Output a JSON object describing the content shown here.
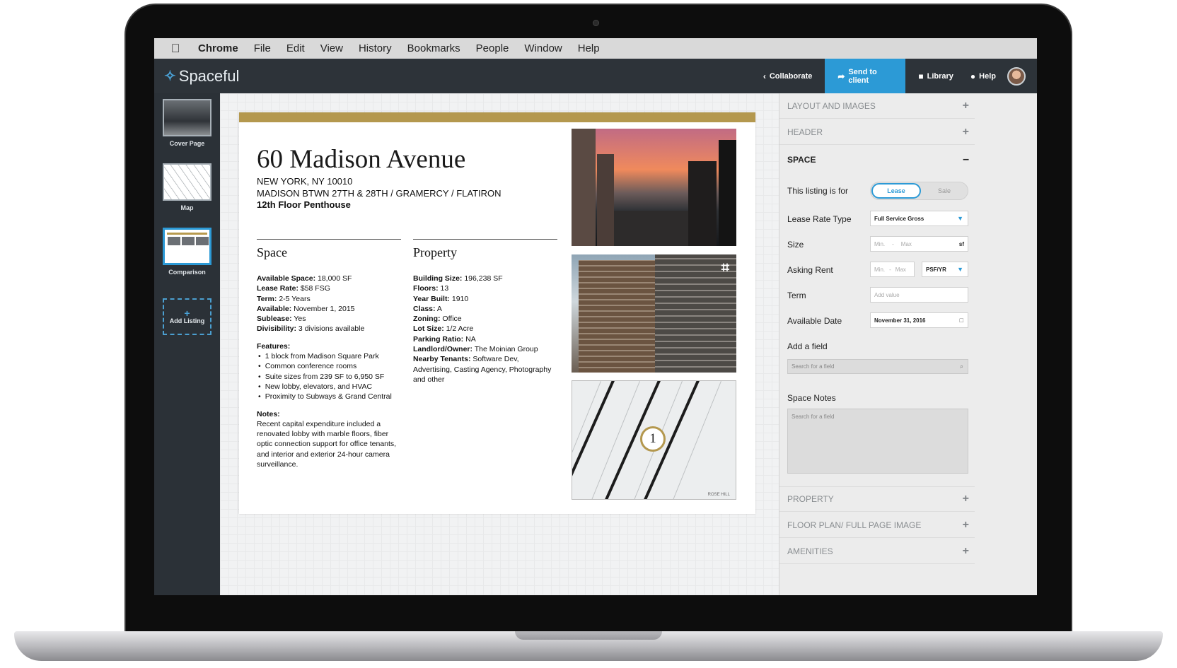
{
  "menubar": {
    "items": [
      "Chrome",
      "File",
      "Edit",
      "View",
      "History",
      "Bookmarks",
      "People",
      "Window",
      "Help"
    ]
  },
  "app": {
    "logo_text": "Spaceful",
    "collaborate_label": "Collaborate",
    "send_label": "Send to client",
    "library_label": "Library",
    "help_label": "Help"
  },
  "rail": {
    "pages": [
      {
        "label": "Cover Page"
      },
      {
        "label": "Map"
      },
      {
        "label": "Comparison"
      }
    ],
    "add_label": "Add Listing"
  },
  "document": {
    "title": "60 Madison Avenue",
    "city": "NEW YORK, NY 10010",
    "cross_streets": "MADISON BTWN 27TH & 28TH / GRAMERCY / FLATIRON",
    "floor": "12th Floor Penthouse",
    "space": {
      "heading": "Space",
      "rows": [
        {
          "k": "Available Space:",
          "v": " 18,000 SF"
        },
        {
          "k": "Lease Rate:",
          "v": " $58 FSG"
        },
        {
          "k": "Term:",
          "v": " 2-5 Years"
        },
        {
          "k": "Available:",
          "v": " November 1, 2015"
        },
        {
          "k": "Sublease:",
          "v": " Yes"
        },
        {
          "k": "Divisibility:",
          "v": " 3 divisions available"
        }
      ],
      "features_heading": "Features:",
      "features": [
        "1 block from Madison Square Park",
        "Common conference rooms",
        "Suite sizes from 239 SF to 6,950 SF",
        "New lobby, elevators, and HVAC",
        "Proximity to Subways & Grand Central"
      ],
      "notes_heading": "Notes:",
      "notes": "Recent capital expenditure included a renovated lobby with marble floors, fiber optic connection support for office tenants, and interior and exterior 24-hour camera surveillance."
    },
    "property": {
      "heading": "Property",
      "rows": [
        {
          "k": "Building Size:",
          "v": " 196,238 SF"
        },
        {
          "k": "Floors:",
          "v": " 13"
        },
        {
          "k": "Year Built:",
          "v": " 1910"
        },
        {
          "k": "Class:",
          "v": " A"
        },
        {
          "k": "Zoning:",
          "v": " Office"
        },
        {
          "k": "Lot Size:",
          "v": " 1/2 Acre"
        },
        {
          "k": "Parking Ratio:",
          "v": " NA"
        },
        {
          "k": "Landlord/Owner:",
          "v": " The Moinian Group"
        },
        {
          "k": "Nearby Tenants:",
          "v": " Software Dev, Advertising, Casting Agency, Photography and other"
        }
      ]
    },
    "map_marker": "1",
    "map_credit": "ROSE HILL"
  },
  "panel": {
    "sections_top": [
      {
        "label": "LAYOUT AND IMAGES",
        "toggle": "+"
      },
      {
        "label": "HEADER",
        "toggle": "+"
      }
    ],
    "space_section": {
      "label": "SPACE",
      "toggle": "–"
    },
    "fields": {
      "listing_for_label": "This listing is for",
      "listing_for_on": "Lease",
      "listing_for_off": "Sale",
      "lease_rate_label": "Lease Rate Type",
      "lease_rate_value": "Full Service Gross",
      "size_label": "Size",
      "size_min": "Min.",
      "size_max": "Max",
      "size_unit": "sf",
      "asking_rent_label": "Asking Rent",
      "asking_min": "Min.",
      "asking_max": "Max",
      "asking_unit": "PSF/YR",
      "term_label": "Term",
      "term_placeholder": "Add value",
      "available_label": "Available Date",
      "available_value": "November 31, 2016",
      "add_field_label": "Add a field",
      "add_field_placeholder": "Search for a field",
      "space_notes_label": "Space Notes",
      "space_notes_placeholder": "Search for a field"
    },
    "sections_bottom": [
      {
        "label": "PROPERTY",
        "toggle": "+"
      },
      {
        "label": "FLOOR PLAN/  FULL PAGE IMAGE",
        "toggle": "+"
      },
      {
        "label": "AMENITIES",
        "toggle": "+"
      }
    ]
  },
  "colors": {
    "accent_blue": "#2c9ad6",
    "gold_bar": "#b4984e",
    "app_header": "#2d3339"
  }
}
